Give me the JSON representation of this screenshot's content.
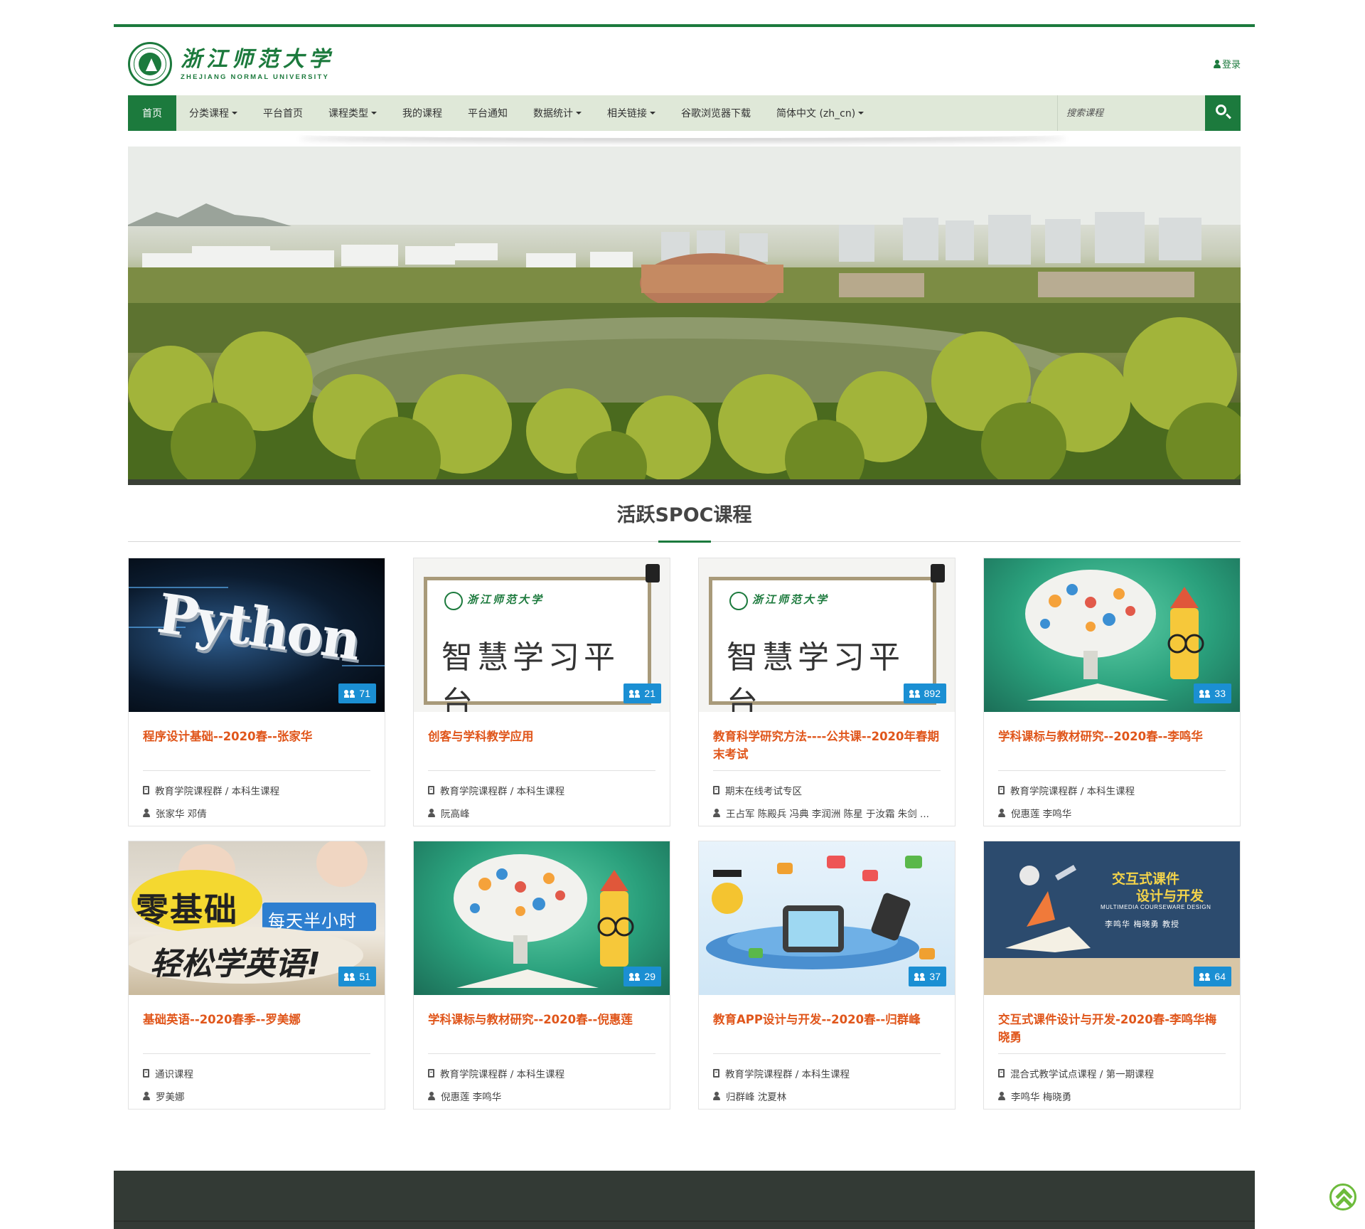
{
  "header": {
    "logo_cn": "浙江师范大学",
    "logo_en": "ZHEJIANG NORMAL UNIVERSITY",
    "login_label": "登录"
  },
  "nav": {
    "items": [
      {
        "label": "首页",
        "active": true,
        "dropdown": false
      },
      {
        "label": "分类课程",
        "active": false,
        "dropdown": true
      },
      {
        "label": "平台首页",
        "active": false,
        "dropdown": false
      },
      {
        "label": "课程类型",
        "active": false,
        "dropdown": true
      },
      {
        "label": "我的课程",
        "active": false,
        "dropdown": false
      },
      {
        "label": "平台通知",
        "active": false,
        "dropdown": false
      },
      {
        "label": "数据统计",
        "active": false,
        "dropdown": true
      },
      {
        "label": "相关链接",
        "active": false,
        "dropdown": true
      },
      {
        "label": "谷歌浏览器下载",
        "active": false,
        "dropdown": false
      },
      {
        "label": "简体中文 (zh_cn)",
        "active": false,
        "dropdown": true
      }
    ],
    "search_placeholder": "搜索课程"
  },
  "section": {
    "title": "活跃SPOC课程"
  },
  "courses": [
    {
      "title": "程序设计基础--2020春--张家华",
      "category": "教育学院课程群 / 本科生课程",
      "teachers": "张家华 邓倩",
      "enrolled": "71",
      "thumb": "python",
      "thumb_text": "Python"
    },
    {
      "title": "创客与学科教学应用",
      "category": "教育学院课程群 / 本科生课程",
      "teachers": "阮高峰",
      "enrolled": "21",
      "thumb": "board",
      "thumb_text": "智慧学习平台"
    },
    {
      "title": "教育科学研究方法----公共课--2020年春期末考试",
      "category": "期末在线考试专区",
      "teachers": "王占军 陈殿兵 冯典 李润洲 陈星 于汝霜 朱剑 ...",
      "enrolled": "892",
      "thumb": "board",
      "thumb_text": "智慧学习平台"
    },
    {
      "title": "学科课标与教材研究--2020春--李鸣华",
      "category": "教育学院课程群 / 本科生课程",
      "teachers": "倪惠莲 李鸣华",
      "enrolled": "33",
      "thumb": "brain",
      "thumb_text": ""
    },
    {
      "title": "基础英语--2020春季--罗美娜",
      "category": "通识课程",
      "teachers": "罗美娜",
      "enrolled": "51",
      "thumb": "english",
      "thumb_text": "零基础 每天半小时 轻松学英语!"
    },
    {
      "title": "学科课标与教材研究--2020春--倪惠莲",
      "category": "教育学院课程群 / 本科生课程",
      "teachers": "倪惠莲 李鸣华",
      "enrolled": "29",
      "thumb": "brain",
      "thumb_text": ""
    },
    {
      "title": "教育APP设计与开发--2020春--归群峰",
      "category": "教育学院课程群 / 本科生课程",
      "teachers": "归群峰 沈夏林",
      "enrolled": "37",
      "thumb": "app",
      "thumb_text": ""
    },
    {
      "title": "交互式课件设计与开发-2020春-李鸣华梅晓勇",
      "category": "混合式教学试点课程 / 第一期课程",
      "teachers": "李鸣华 梅晓勇",
      "enrolled": "64",
      "thumb": "inter",
      "thumb_text": "交互式课件 设计与开发 MULTIMEDIA COURSEWARE DESIGN 李鸣华 梅晓勇 教授"
    }
  ],
  "thumb_text": {
    "board_logo": "浙江师范大学",
    "english_line1": "零基础",
    "english_line2": "每天半小时",
    "english_line3": "轻松学英语!",
    "inter_title1": "交互式课件",
    "inter_title2": "设计与开发",
    "inter_sub": "MULTIMEDIA COURSEWARE DESIGN",
    "inter_names": "李鸣华  梅晓勇  教授"
  },
  "colors": {
    "brand_green": "#1c7a3d",
    "nav_bg": "#dfe8d8",
    "title_orange": "#e0561b",
    "badge_blue": "#1b8fd3",
    "footer": "#333a35"
  }
}
